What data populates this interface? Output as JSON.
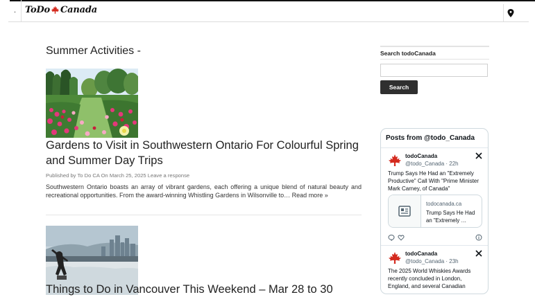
{
  "header": {
    "dot": ".",
    "logo_left": "ToDo",
    "logo_right": "Canada"
  },
  "main": {
    "page_title": "Summer Activities -",
    "posts": [
      {
        "title": "Gardens to Visit in Southwestern Ontario For Colourful Spring and Summer Day Trips",
        "meta": "Published by To Do CA On March 25, 2025 Leave a response",
        "excerpt": "Southwestern Ontario boasts an array of vibrant gardens, each offering a unique blend of natural beauty and recreational opportunities. From the award-winning Whistling Gardens in Wilsonville to…",
        "read_more": "Read more »"
      },
      {
        "title": "Things to Do in Vancouver This Weekend – Mar 28 to 30"
      }
    ]
  },
  "sidebar": {
    "search_heading": "Search todoCanada",
    "search_value": "",
    "search_button": "Search",
    "feed": {
      "title": "Posts from @todo_Canada",
      "tweets": [
        {
          "name": "todoCanada",
          "handle": "@todo_Canada · 22h",
          "text": "Trump Says He Had an \"Extremely Productive\" Call With \"Prime Minister Mark Carney, of Canada\"",
          "card_domain": "todocanada.ca",
          "card_title": "Trump Says He Had an \"Extremely …"
        },
        {
          "name": "todoCanada",
          "handle": "@todo_Canada · 23h",
          "text": "The 2025 World Whiskies Awards recently concluded in London, England, and several Canadian"
        }
      ]
    }
  },
  "colors": {
    "accent_red": "#d42a1e",
    "button_dark": "#2f2f2f"
  }
}
